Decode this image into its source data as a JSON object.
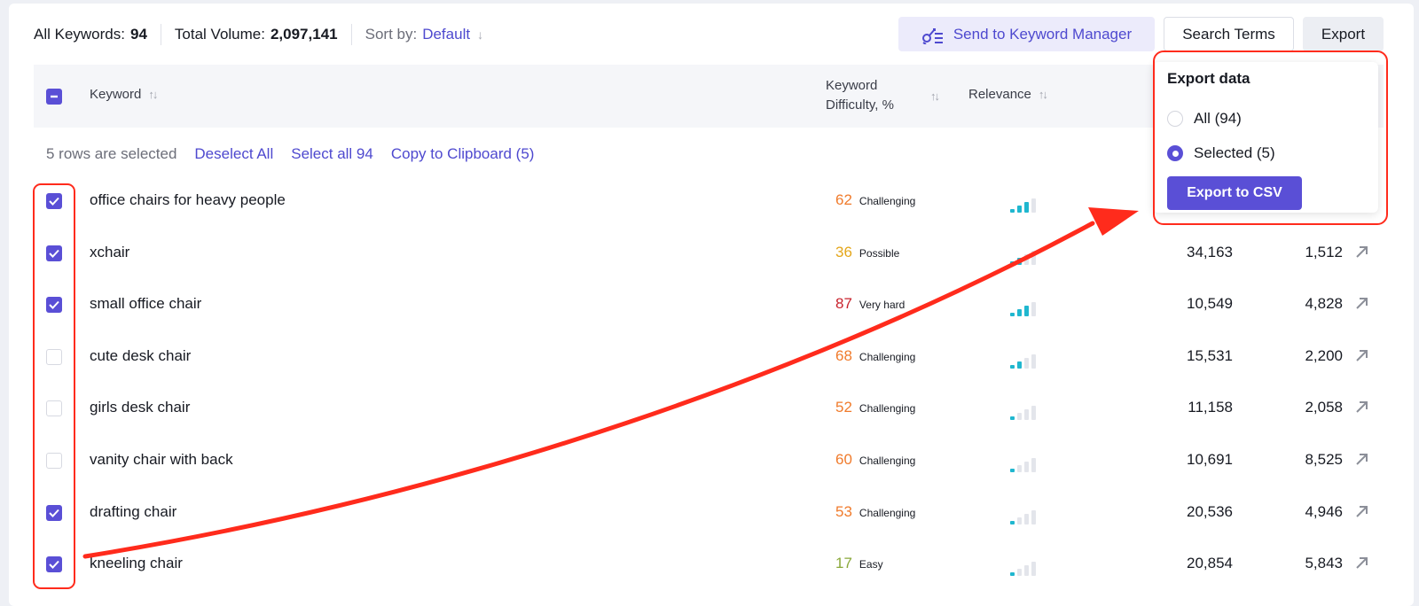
{
  "toolbar": {
    "all_keywords_label": "All Keywords:",
    "all_keywords_value": "94",
    "total_volume_label": "Total Volume:",
    "total_volume_value": "2,097,141",
    "sort_label": "Sort by:",
    "sort_value": "Default",
    "send_button": "Send to Keyword Manager",
    "search_terms_button": "Search Terms",
    "export_button": "Export"
  },
  "table_header": {
    "keyword": "Keyword",
    "difficulty_line1": "Keyword",
    "difficulty_line2": "Difficulty, %",
    "relevance": "Relevance"
  },
  "selection": {
    "status": "5 rows are selected",
    "deselect_all": "Deselect All",
    "select_all": "Select all 94",
    "copy": "Copy to Clipboard (5)"
  },
  "colors": {
    "accent": "#5a4fd6",
    "annotation": "#ff2b1c",
    "challenging": "#f07b2c",
    "possible": "#e4a61a",
    "very_hard": "#c8232d",
    "easy": "#8aa83a",
    "relevance_on": "#20b7cf",
    "relevance_off": "#e3e5eb"
  },
  "rows": [
    {
      "keyword": "office chairs for heavy people",
      "checked": true,
      "kd": "62",
      "kd_label": "Challenging",
      "relevance": 3,
      "volume": "",
      "count": ""
    },
    {
      "keyword": "xchair",
      "checked": true,
      "kd": "36",
      "kd_label": "Possible",
      "relevance": 2,
      "volume": "34,163",
      "count": "1,512"
    },
    {
      "keyword": "small office chair",
      "checked": true,
      "kd": "87",
      "kd_label": "Very hard",
      "relevance": 3,
      "volume": "10,549",
      "count": "4,828"
    },
    {
      "keyword": "cute desk chair",
      "checked": false,
      "kd": "68",
      "kd_label": "Challenging",
      "relevance": 2,
      "volume": "15,531",
      "count": "2,200"
    },
    {
      "keyword": "girls desk chair",
      "checked": false,
      "kd": "52",
      "kd_label": "Challenging",
      "relevance": 1,
      "volume": "11,158",
      "count": "2,058"
    },
    {
      "keyword": "vanity chair with back",
      "checked": false,
      "kd": "60",
      "kd_label": "Challenging",
      "relevance": 1,
      "volume": "10,691",
      "count": "8,525"
    },
    {
      "keyword": "drafting chair",
      "checked": true,
      "kd": "53",
      "kd_label": "Challenging",
      "relevance": 1,
      "volume": "20,536",
      "count": "4,946"
    },
    {
      "keyword": "kneeling chair",
      "checked": true,
      "kd": "17",
      "kd_label": "Easy",
      "relevance": 1,
      "volume": "20,854",
      "count": "5,843"
    }
  ],
  "export_popover": {
    "title": "Export data",
    "option_all": "All (94)",
    "option_selected": "Selected (5)",
    "selected_option": "selected",
    "csv_button": "Export to CSV"
  }
}
